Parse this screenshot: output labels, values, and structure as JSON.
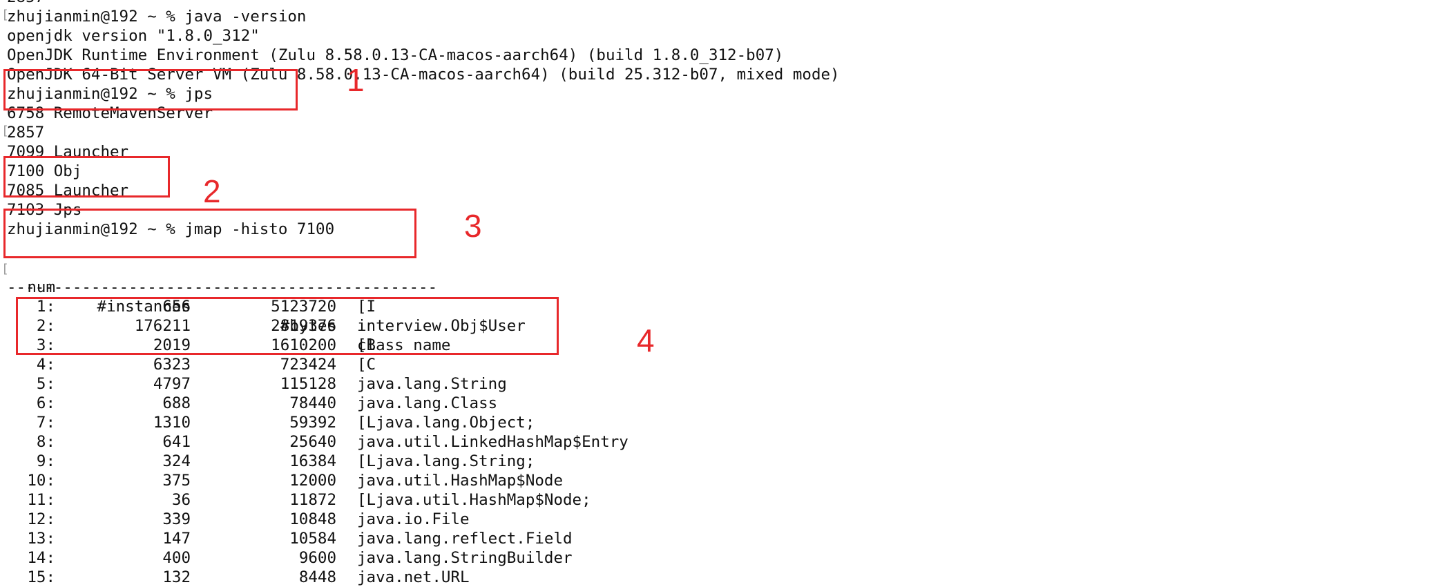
{
  "terminal": {
    "lines": {
      "clipped_top": "2857",
      "prompt_version": "zhujianmin@192 ~ % java -version",
      "openjdk_version": "openjdk version \"1.8.0_312\"",
      "runtime_env": "OpenJDK Runtime Environment (Zulu 8.58.0.13-CA-macos-aarch64) (build 1.8.0_312-b07)",
      "server_vm": "OpenJDK 64-Bit Server VM (Zulu 8.58.0.13-CA-macos-aarch64) (build 25.312-b07, mixed mode)",
      "prompt_jps": "zhujianmin@192 ~ % jps",
      "jps_1": "6758 RemoteMavenServer",
      "jps_2": "2857",
      "jps_3": "7099 Launcher",
      "jps_4": "7100 Obj",
      "jps_5": "7085 Launcher",
      "jps_6": "7103 Jps",
      "prompt_jmap": "zhujianmin@192 ~ % jmap -histo 7100"
    },
    "histogram": {
      "headers": {
        "num": "num",
        "instances": "#instances",
        "bytes": "#bytes",
        "class_name": "class name"
      },
      "separator": "----------------------------------------------",
      "rows": [
        {
          "num": "1:",
          "instances": "656",
          "bytes": "5123720",
          "class_name": "[I"
        },
        {
          "num": "2:",
          "instances": "176211",
          "bytes": "2819376",
          "class_name": "interview.Obj$User"
        },
        {
          "num": "3:",
          "instances": "2019",
          "bytes": "1610200",
          "class_name": "[B"
        },
        {
          "num": "4:",
          "instances": "6323",
          "bytes": "723424",
          "class_name": "[C"
        },
        {
          "num": "5:",
          "instances": "4797",
          "bytes": "115128",
          "class_name": "java.lang.String"
        },
        {
          "num": "6:",
          "instances": "688",
          "bytes": "78440",
          "class_name": "java.lang.Class"
        },
        {
          "num": "7:",
          "instances": "1310",
          "bytes": "59392",
          "class_name": "[Ljava.lang.Object;"
        },
        {
          "num": "8:",
          "instances": "641",
          "bytes": "25640",
          "class_name": "java.util.LinkedHashMap$Entry"
        },
        {
          "num": "9:",
          "instances": "324",
          "bytes": "16384",
          "class_name": "[Ljava.lang.String;"
        },
        {
          "num": "10:",
          "instances": "375",
          "bytes": "12000",
          "class_name": "java.util.HashMap$Node"
        },
        {
          "num": "11:",
          "instances": "36",
          "bytes": "11872",
          "class_name": "[Ljava.util.HashMap$Node;"
        },
        {
          "num": "12:",
          "instances": "339",
          "bytes": "10848",
          "class_name": "java.io.File"
        },
        {
          "num": "13:",
          "instances": "147",
          "bytes": "10584",
          "class_name": "java.lang.reflect.Field"
        },
        {
          "num": "14:",
          "instances": "400",
          "bytes": "9600",
          "class_name": "java.lang.StringBuilder"
        },
        {
          "num": "15:",
          "instances": "132",
          "bytes": "8448",
          "class_name": "java.net.URL"
        }
      ]
    }
  },
  "annotations": {
    "label_1": "1",
    "label_2": "2",
    "label_3": "3",
    "label_4": "4",
    "color": "#e8282b"
  }
}
